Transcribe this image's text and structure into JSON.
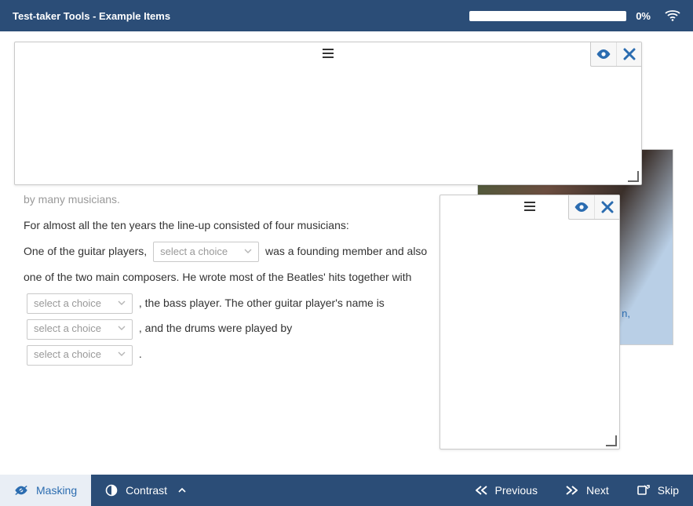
{
  "header": {
    "title": "Test-taker Tools - Example Items",
    "progress_pct": "0%"
  },
  "body": {
    "partial_top": "by many musicians.",
    "line1": "For almost all the ten years the line-up consisted of four musicians:",
    "frag_a": "One of the guitar players,",
    "frag_b": "was a founding member and also one of the two main composers. He wrote most of the Beatles' hits together with",
    "frag_c": ", the bass player. The other guitar player's name is",
    "frag_d": ", and the drums were played by",
    "frag_e": ".",
    "select_placeholder": "select a choice",
    "caption_fragment": "n,"
  },
  "footer": {
    "masking": "Masking",
    "contrast": "Contrast",
    "previous": "Previous",
    "next": "Next",
    "skip": "Skip"
  }
}
